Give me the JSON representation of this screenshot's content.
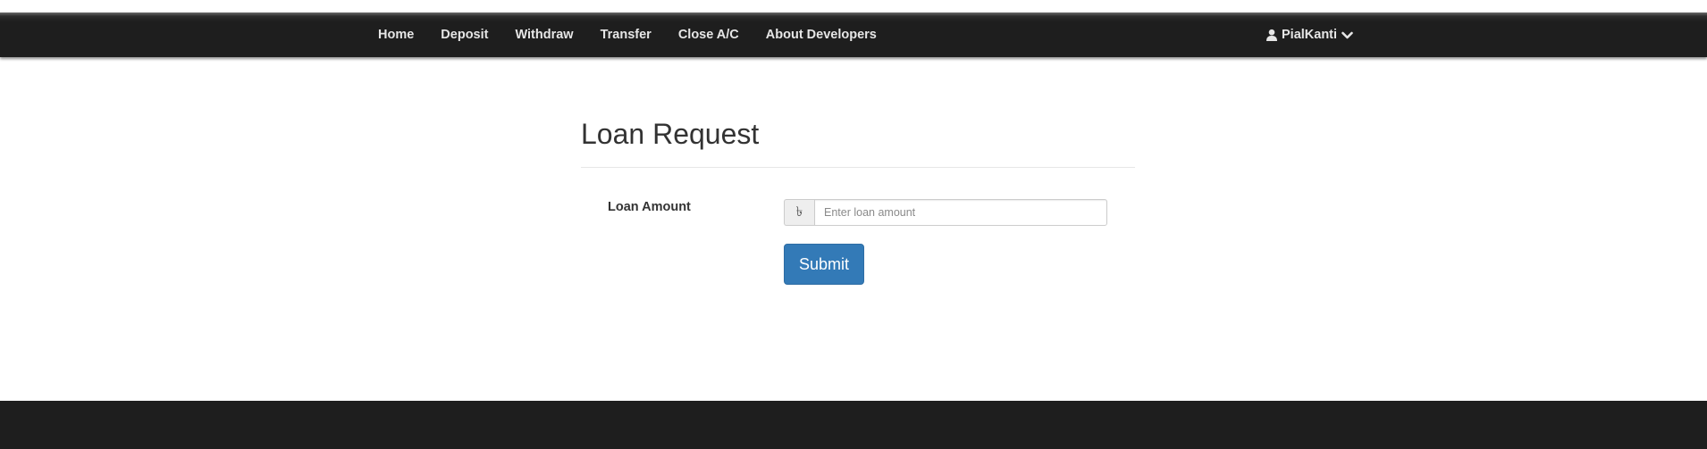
{
  "nav": {
    "links": [
      "Home",
      "Deposit",
      "Withdraw",
      "Transfer",
      "Close A/C",
      "About Developers"
    ],
    "user_name": "PialKanti",
    "user_icon": "user-icon",
    "dropdown_icon": "chevron-down-icon"
  },
  "form": {
    "title": "Loan Request",
    "amount_label": "Loan Amount",
    "currency_symbol": "৳",
    "amount_placeholder": "Enter loan amount",
    "amount_value": "",
    "submit_label": "Submit"
  },
  "colors": {
    "navbar": "#1e1e1e",
    "primary_button": "#337ab7",
    "footer": "#1e1e1e"
  }
}
